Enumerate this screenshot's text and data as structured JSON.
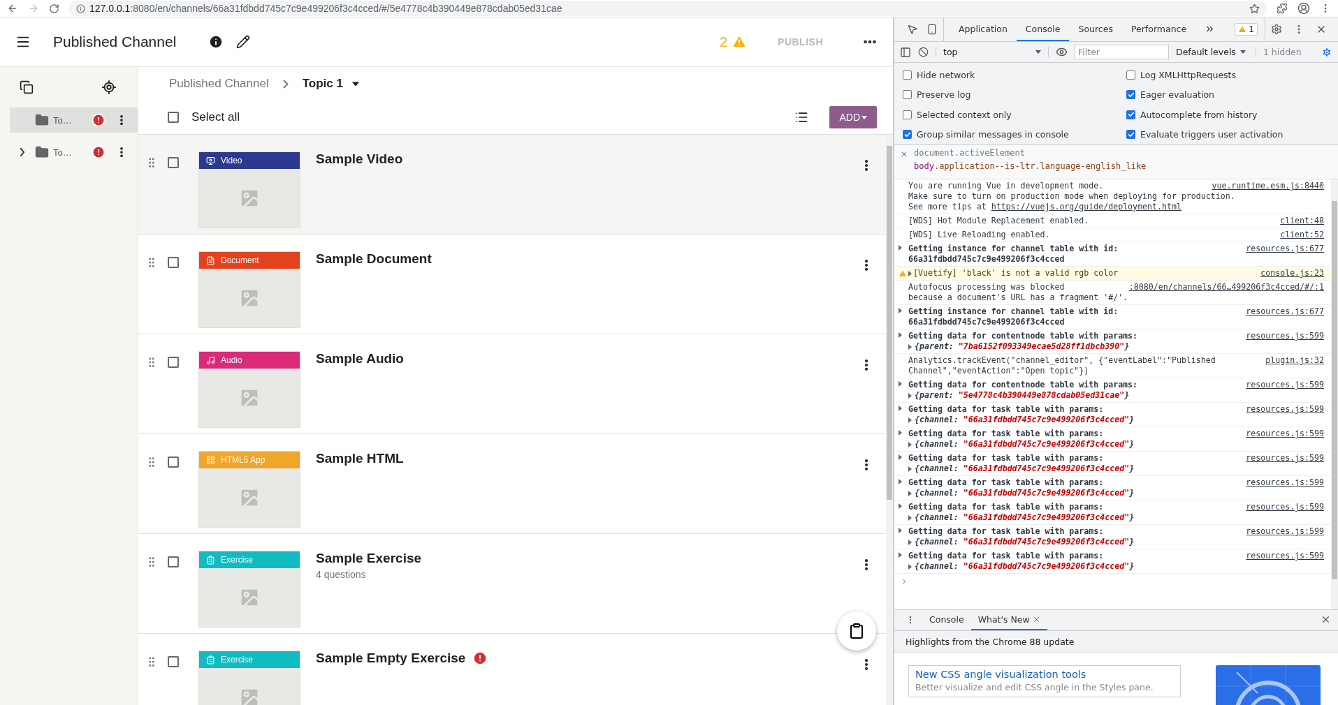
{
  "browser": {
    "url_host": "127.0.0.1",
    "url_path": ":8080/en/channels/66a31fdbdd745c7c9e499206f3c4cced/#/5e4778c4b390449e878cdab05ed31cae",
    "forward_disabled": true
  },
  "app": {
    "title": "Published Channel",
    "warning_count": "2",
    "publish": {
      "label": "PUBLISH",
      "disabled": true
    },
    "sidebar": {
      "items": [
        {
          "label": "To…",
          "selected": true,
          "has_children": false,
          "error": true
        },
        {
          "label": "To…",
          "selected": false,
          "has_children": true,
          "expanded": false,
          "error": true
        }
      ]
    },
    "breadcrumb": [
      {
        "label": "Published Channel",
        "current": false
      },
      {
        "label": "Topic 1",
        "current": true
      }
    ],
    "select_all": {
      "label": "Select all",
      "checked": false
    },
    "add_button": "ADD",
    "nodes": [
      {
        "kind": "video",
        "badge": "Video",
        "color": "#2b3990",
        "title": "Sample Video",
        "checked": false,
        "error": false,
        "hovered": true
      },
      {
        "kind": "document",
        "badge": "Document",
        "color": "#e2431e",
        "title": "Sample Document",
        "checked": false,
        "error": false,
        "hovered": false
      },
      {
        "kind": "audio",
        "badge": "Audio",
        "color": "#dc2a7a",
        "title": "Sample Audio",
        "checked": false,
        "error": false,
        "hovered": false
      },
      {
        "kind": "html5",
        "badge": "HTML5 App",
        "color": "#f0a62a",
        "title": "Sample HTML",
        "checked": false,
        "error": false,
        "hovered": false
      },
      {
        "kind": "exercise",
        "badge": "Exercise",
        "color": "#10bcbf",
        "title": "Sample Exercise",
        "subtitle": "4 questions",
        "checked": false,
        "error": false,
        "hovered": false
      },
      {
        "kind": "exercise",
        "badge": "Exercise",
        "color": "#10bcbf",
        "title": "Sample Empty Exercise",
        "checked": false,
        "error": true,
        "hovered": false
      }
    ]
  },
  "devtools": {
    "tabs": [
      {
        "label": "Application",
        "selected": false
      },
      {
        "label": "Console",
        "selected": true
      },
      {
        "label": "Sources",
        "selected": false
      },
      {
        "label": "Performance",
        "selected": false
      }
    ],
    "warning_count": "1",
    "context": "top",
    "filter_placeholder": "Filter",
    "levels": "Default levels",
    "hidden": "1 hidden",
    "settings": [
      {
        "label": "Hide network",
        "checked": false
      },
      {
        "label": "Log XMLHttpRequests",
        "checked": false
      },
      {
        "label": "Preserve log",
        "checked": false
      },
      {
        "label": "Eager evaluation",
        "checked": true
      },
      {
        "label": "Selected context only",
        "checked": false
      },
      {
        "label": "Autocomplete from history",
        "checked": true
      },
      {
        "label": "Group similar messages in console",
        "checked": true
      },
      {
        "label": "Evaluate triggers user activation",
        "checked": true
      }
    ],
    "active_element": {
      "expression": "document.activeElement",
      "result_tag": "body",
      "result_rest": ".application--is-ltr.language-english_like"
    },
    "messages": [
      {
        "kind": "log",
        "lines": [
          "You are running Vue in development mode.",
          "Make sure to turn on production mode when deploying for production.",
          "See more tips at "
        ],
        "link": "https://vuejs.org/guide/deployment.html",
        "source": "vue.runtime.esm.js:8440"
      },
      {
        "kind": "log",
        "lines": [
          "[WDS] Hot Module Replacement enabled."
        ],
        "source": "client:48"
      },
      {
        "kind": "log",
        "lines": [
          "[WDS] Live Reloading enabled."
        ],
        "source": "client:52"
      },
      {
        "kind": "group",
        "lines": [
          "Getting instance for channel table with id:",
          "66a31fdbdd745c7c9e499206f3c4cced"
        ],
        "source": "resources.js:677"
      },
      {
        "kind": "warning",
        "lines": [
          "[Vuetify] 'black' is not a valid rgb color"
        ],
        "source": "console.js:23"
      },
      {
        "kind": "log",
        "lines": [
          "Autofocus processing was blocked",
          "because a document's URL has a fragment '#/'."
        ],
        "source": ":8080/en/channels/66…499206f3c4cced/#/:1"
      },
      {
        "kind": "group",
        "lines": [
          "Getting instance for channel table with id:",
          "66a31fdbdd745c7c9e499206f3c4cced"
        ],
        "source": "resources.js:677"
      },
      {
        "kind": "group",
        "lines": [
          "Getting data for contentnode table with params:"
        ],
        "object": [
          "{parent: ",
          "\"7ba6152f093349ecae5d28ff1dbcb390\"",
          "}"
        ],
        "source": "resources.js:599"
      },
      {
        "kind": "log",
        "lines": [
          "Analytics.trackEvent(\"channel_editor\", {\"eventLabel\":\"Published",
          "Channel\",\"eventAction\":\"Open topic\"})"
        ],
        "source": "plugin.js:32"
      },
      {
        "kind": "group",
        "lines": [
          "Getting data for contentnode table with params:"
        ],
        "object": [
          "{parent: ",
          "\"5e4778c4b390449e878cdab05ed31cae\"",
          "}"
        ],
        "source": "resources.js:599"
      },
      {
        "kind": "group",
        "lines": [
          "Getting data for task table with params:"
        ],
        "object": [
          "{channel: ",
          "\"66a31fdbdd745c7c9e499206f3c4cced\"",
          "}"
        ],
        "source": "resources.js:599"
      },
      {
        "kind": "group",
        "lines": [
          "Getting data for task table with params:"
        ],
        "object": [
          "{channel: ",
          "\"66a31fdbdd745c7c9e499206f3c4cced\"",
          "}"
        ],
        "source": "resources.js:599"
      },
      {
        "kind": "group",
        "lines": [
          "Getting data for task table with params:"
        ],
        "object": [
          "{channel: ",
          "\"66a31fdbdd745c7c9e499206f3c4cced\"",
          "}"
        ],
        "source": "resources.js:599"
      },
      {
        "kind": "group",
        "lines": [
          "Getting data for task table with params:"
        ],
        "object": [
          "{channel: ",
          "\"66a31fdbdd745c7c9e499206f3c4cced\"",
          "}"
        ],
        "source": "resources.js:599"
      },
      {
        "kind": "group",
        "lines": [
          "Getting data for task table with params:"
        ],
        "object": [
          "{channel: ",
          "\"66a31fdbdd745c7c9e499206f3c4cced\"",
          "}"
        ],
        "source": "resources.js:599"
      },
      {
        "kind": "group",
        "lines": [
          "Getting data for task table with params:"
        ],
        "object": [
          "{channel: ",
          "\"66a31fdbdd745c7c9e499206f3c4cced\"",
          "}"
        ],
        "source": "resources.js:599"
      },
      {
        "kind": "group",
        "lines": [
          "Getting data for task table with params:"
        ],
        "object": [
          "{channel: ",
          "\"66a31fdbdd745c7c9e499206f3c4cced\"",
          "}"
        ],
        "source": "resources.js:599"
      }
    ],
    "drawer": {
      "tabs": [
        {
          "label": "Console",
          "selected": false,
          "closable": false
        },
        {
          "label": "What's New",
          "selected": true,
          "closable": true
        }
      ],
      "headline": "Highlights from the Chrome 88 update",
      "card": {
        "title": "New CSS angle visualization tools",
        "description": "Better visualize and edit CSS angle in the Styles pane."
      }
    }
  }
}
